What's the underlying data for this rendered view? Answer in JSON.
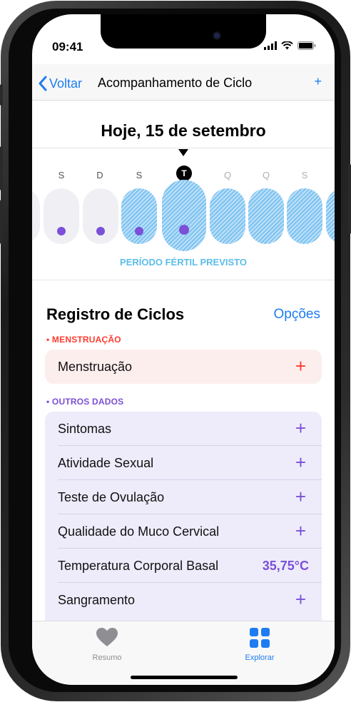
{
  "status": {
    "time": "09:41"
  },
  "nav": {
    "back": "Voltar",
    "title": "Acompanhamento de Ciclo",
    "add": "+"
  },
  "date_title": "Hoje, 15 de setembro",
  "week": {
    "days": [
      {
        "label": "S",
        "state": "past"
      },
      {
        "label": "D",
        "state": "past"
      },
      {
        "label": "S",
        "state": "past"
      },
      {
        "label": "T",
        "state": "today"
      },
      {
        "label": "Q",
        "state": "future"
      },
      {
        "label": "Q",
        "state": "future"
      },
      {
        "label": "S",
        "state": "future"
      }
    ],
    "fertile_label": "PERÍODO FÉRTIL PREVISTO"
  },
  "log": {
    "title": "Registro de Ciclos",
    "options": "Opções",
    "menstruation_header": "• MENSTRUAÇÃO",
    "menstruation_row": "Menstruação",
    "other_header": "• OUTROS DADOS",
    "rows": [
      {
        "label": "Sintomas",
        "value": "+"
      },
      {
        "label": "Atividade Sexual",
        "value": "+"
      },
      {
        "label": "Teste de Ovulação",
        "value": "+"
      },
      {
        "label": "Qualidade do Muco Cervical",
        "value": "+"
      },
      {
        "label": "Temperatura Corporal Basal",
        "value": "35,75°C"
      },
      {
        "label": "Sangramento",
        "value": "+"
      }
    ]
  },
  "tabs": {
    "summary": "Resumo",
    "explore": "Explorar"
  },
  "colors": {
    "accent": "#1e7cf2",
    "menstruation": "#ff3b30",
    "other": "#7b4fd8",
    "fertile": "#5bbde8",
    "menstruation_bg": "#fdeeee",
    "other_bg": "#eeecfb"
  }
}
